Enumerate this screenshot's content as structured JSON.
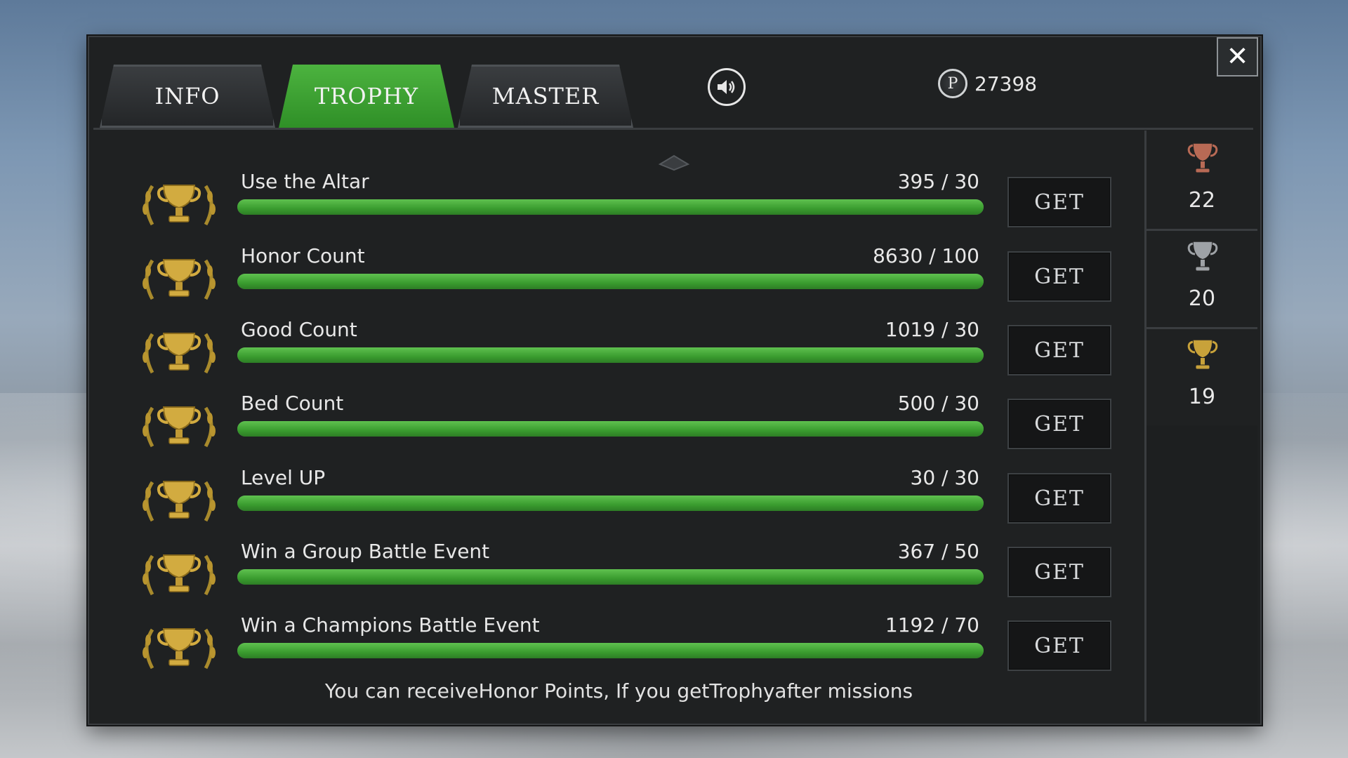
{
  "tabs": [
    {
      "label": "INFO",
      "active": false
    },
    {
      "label": "TROPHY",
      "active": true
    },
    {
      "label": "MASTER",
      "active": false
    }
  ],
  "close_label": "✕",
  "points": {
    "icon_letter": "P",
    "value": "27398"
  },
  "trophies": [
    {
      "title": "Use the Altar",
      "progress": "395 / 30",
      "button": "GET",
      "fill_fraction": 1.0
    },
    {
      "title": "Honor Count",
      "progress": "8630 / 100",
      "button": "GET",
      "fill_fraction": 1.0
    },
    {
      "title": "Good Count",
      "progress": "1019 / 30",
      "button": "GET",
      "fill_fraction": 1.0
    },
    {
      "title": "Bed Count",
      "progress": "500 / 30",
      "button": "GET",
      "fill_fraction": 1.0
    },
    {
      "title": "Level UP",
      "progress": "30 / 30",
      "button": "GET",
      "fill_fraction": 1.0
    },
    {
      "title": "Win a Group Battle Event",
      "progress": "367 / 50",
      "button": "GET",
      "fill_fraction": 1.0
    },
    {
      "title": "Win a Champions Battle Event",
      "progress": "1192 / 70",
      "button": "GET",
      "fill_fraction": 1.0
    }
  ],
  "footer_note": "You can receiveHonor Points, If you getTrophyafter missions",
  "trophy_counts": [
    {
      "tier": "bronze",
      "count": "22",
      "color": "#b86a55"
    },
    {
      "tier": "silver",
      "count": "20",
      "color": "#9ea2a6"
    },
    {
      "tier": "gold",
      "count": "19",
      "color": "#c8a23a"
    }
  ],
  "colors": {
    "accent_green": "#3fa534",
    "panel": "#1f2122"
  }
}
